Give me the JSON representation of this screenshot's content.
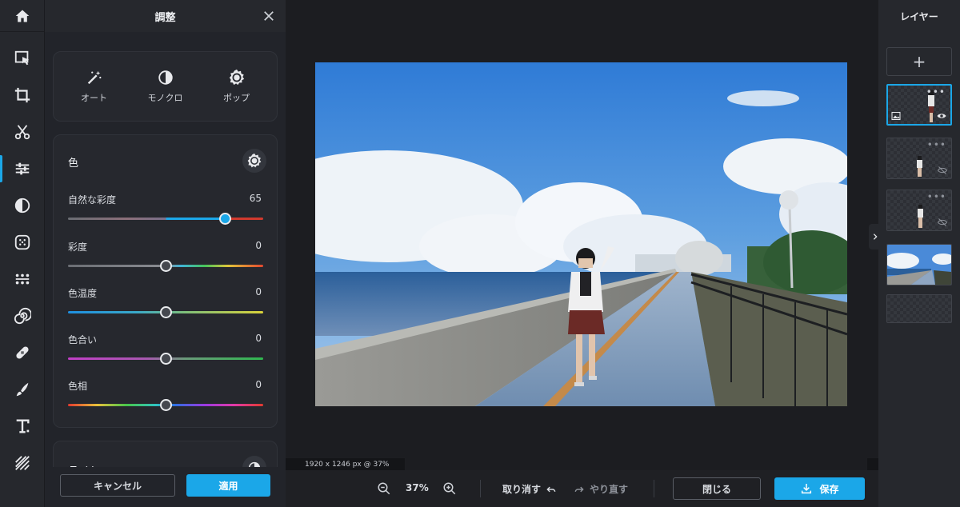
{
  "toolbar": {
    "items": [
      {
        "icon": "home-icon"
      },
      {
        "icon": "select-arrange-icon"
      },
      {
        "icon": "crop-icon"
      },
      {
        "icon": "cut-scissors-icon"
      },
      {
        "icon": "adjust-sliders-icon",
        "active": true
      },
      {
        "icon": "filter-contrast-icon"
      },
      {
        "icon": "effects-grid-icon"
      },
      {
        "icon": "liquify-icon"
      },
      {
        "icon": "spiral-distort-icon"
      },
      {
        "icon": "retouch-bandage-icon"
      },
      {
        "icon": "brush-icon"
      },
      {
        "icon": "text-icon"
      },
      {
        "icon": "texture-lines-icon"
      }
    ]
  },
  "panel": {
    "title": "調整",
    "presets": [
      {
        "label": "オート",
        "icon": "magic-wand-icon"
      },
      {
        "label": "モノクロ",
        "icon": "half-circle-icon"
      },
      {
        "label": "ポップ",
        "icon": "sun-badge-icon"
      }
    ],
    "color_section": {
      "title": "色",
      "sliders": [
        {
          "label": "自然な彩度",
          "value": "65",
          "position": 0.803
        },
        {
          "label": "彩度",
          "value": "0",
          "position": 0.5
        },
        {
          "label": "色温度",
          "value": "0",
          "position": 0.5
        },
        {
          "label": "色合い",
          "value": "0",
          "position": 0.5
        },
        {
          "label": "色相",
          "value": "0",
          "position": 0.5
        }
      ]
    },
    "light_section": {
      "title": "ライト"
    },
    "cancel_label": "キャンセル",
    "apply_label": "適用"
  },
  "canvas": {
    "info": "1920 x 1246 px @ 37%"
  },
  "bottom": {
    "zoom": "37%",
    "undo_label": "取り消す",
    "redo_label": "やり直す",
    "close_label": "閉じる",
    "save_label": "保存"
  },
  "layers": {
    "title": "レイヤー",
    "add_label": "+",
    "items": [
      {
        "name": "person-layer",
        "selected": true,
        "visible": true,
        "kind": "image"
      },
      {
        "name": "person-layer-2",
        "selected": false,
        "visible": false
      },
      {
        "name": "person-layer-3",
        "selected": false,
        "visible": false
      },
      {
        "name": "background-photo-layer",
        "selected": false,
        "visible": true
      },
      {
        "name": "empty-layer",
        "selected": false,
        "visible": true
      }
    ]
  },
  "colors": {
    "accent": "#1ba7e8",
    "panel": "#22242a",
    "toolbar": "#26282d",
    "canvas": "#1c1d21"
  }
}
